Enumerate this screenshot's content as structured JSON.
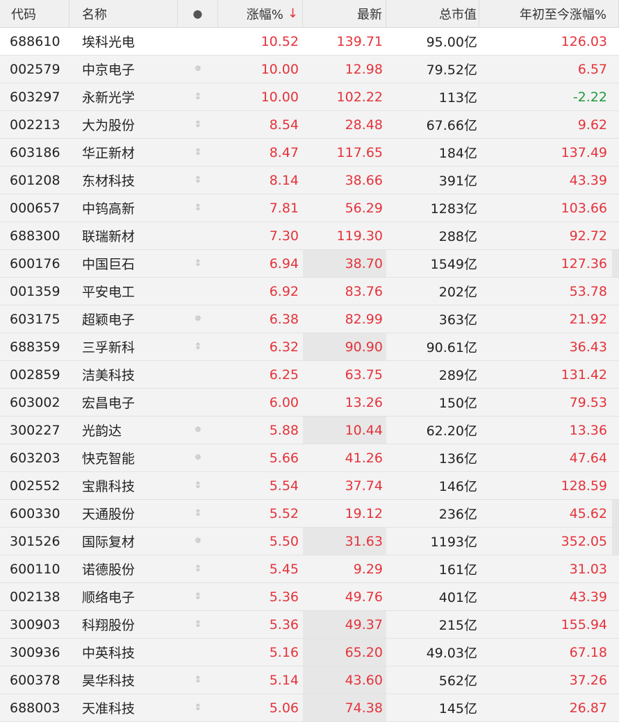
{
  "columns": {
    "code": "代码",
    "name": "名称",
    "dot": "●",
    "change_pct": "涨幅%",
    "sort_arrow": "↓",
    "last": "最新",
    "market_cap": "总市值",
    "ytd_pct": "年初至今涨幅%"
  },
  "rows": [
    {
      "code": "688610",
      "name": "埃科光电",
      "mark": "",
      "change": "10.52",
      "last": "139.71",
      "cap": "95.00亿",
      "ytd": "126.03",
      "ytd_dir": "up"
    },
    {
      "code": "002579",
      "name": "中京电子",
      "mark": "✵",
      "change": "10.00",
      "last": "12.98",
      "cap": "79.52亿",
      "ytd": "6.57",
      "ytd_dir": "up"
    },
    {
      "code": "603297",
      "name": "永新光学",
      "mark": "⇕",
      "change": "10.00",
      "last": "102.22",
      "cap": "113亿",
      "ytd": "-2.22",
      "ytd_dir": "down"
    },
    {
      "code": "002213",
      "name": "大为股份",
      "mark": "⇕",
      "change": "8.54",
      "last": "28.48",
      "cap": "67.66亿",
      "ytd": "9.62",
      "ytd_dir": "up"
    },
    {
      "code": "603186",
      "name": "华正新材",
      "mark": "⇕",
      "change": "8.47",
      "last": "117.65",
      "cap": "184亿",
      "ytd": "137.49",
      "ytd_dir": "up"
    },
    {
      "code": "601208",
      "name": "东材科技",
      "mark": "⇕",
      "change": "8.14",
      "last": "38.66",
      "cap": "391亿",
      "ytd": "43.39",
      "ytd_dir": "up"
    },
    {
      "code": "000657",
      "name": "中钨高新",
      "mark": "⇕",
      "change": "7.81",
      "last": "56.29",
      "cap": "1283亿",
      "ytd": "103.66",
      "ytd_dir": "up"
    },
    {
      "code": "688300",
      "name": "联瑞新材",
      "mark": "",
      "change": "7.30",
      "last": "119.30",
      "cap": "288亿",
      "ytd": "92.72",
      "ytd_dir": "up"
    },
    {
      "code": "600176",
      "name": "中国巨石",
      "mark": "⇕",
      "change": "6.94",
      "last": "38.70",
      "cap": "1549亿",
      "ytd": "127.36",
      "ytd_dir": "up"
    },
    {
      "code": "001359",
      "name": "平安电工",
      "mark": "",
      "change": "6.92",
      "last": "83.76",
      "cap": "202亿",
      "ytd": "53.78",
      "ytd_dir": "up"
    },
    {
      "code": "603175",
      "name": "超颖电子",
      "mark": "✵",
      "change": "6.38",
      "last": "82.99",
      "cap": "363亿",
      "ytd": "21.92",
      "ytd_dir": "up"
    },
    {
      "code": "688359",
      "name": "三孚新科",
      "mark": "⇕",
      "change": "6.32",
      "last": "90.90",
      "cap": "90.61亿",
      "ytd": "36.43",
      "ytd_dir": "up"
    },
    {
      "code": "002859",
      "name": "洁美科技",
      "mark": "",
      "change": "6.25",
      "last": "63.75",
      "cap": "289亿",
      "ytd": "131.42",
      "ytd_dir": "up"
    },
    {
      "code": "603002",
      "name": "宏昌电子",
      "mark": "",
      "change": "6.00",
      "last": "13.26",
      "cap": "150亿",
      "ytd": "79.53",
      "ytd_dir": "up"
    },
    {
      "code": "300227",
      "name": "光韵达",
      "mark": "✵",
      "change": "5.88",
      "last": "10.44",
      "cap": "62.20亿",
      "ytd": "13.36",
      "ytd_dir": "up"
    },
    {
      "code": "603203",
      "name": "快克智能",
      "mark": "✵",
      "change": "5.66",
      "last": "41.26",
      "cap": "136亿",
      "ytd": "47.64",
      "ytd_dir": "up"
    },
    {
      "code": "002552",
      "name": "宝鼎科技",
      "mark": "⇕",
      "change": "5.54",
      "last": "37.74",
      "cap": "146亿",
      "ytd": "128.59",
      "ytd_dir": "up"
    },
    {
      "code": "600330",
      "name": "天通股份",
      "mark": "⇕",
      "change": "5.52",
      "last": "19.12",
      "cap": "236亿",
      "ytd": "45.62",
      "ytd_dir": "up"
    },
    {
      "code": "301526",
      "name": "国际复材",
      "mark": "✵",
      "change": "5.50",
      "last": "31.63",
      "cap": "1193亿",
      "ytd": "352.05",
      "ytd_dir": "up"
    },
    {
      "code": "600110",
      "name": "诺德股份",
      "mark": "⇕",
      "change": "5.45",
      "last": "9.29",
      "cap": "161亿",
      "ytd": "31.03",
      "ytd_dir": "up"
    },
    {
      "code": "002138",
      "name": "顺络电子",
      "mark": "⇕",
      "change": "5.36",
      "last": "49.76",
      "cap": "401亿",
      "ytd": "43.39",
      "ytd_dir": "up"
    },
    {
      "code": "300903",
      "name": "科翔股份",
      "mark": "⇕",
      "change": "5.36",
      "last": "49.37",
      "cap": "215亿",
      "ytd": "155.94",
      "ytd_dir": "up"
    },
    {
      "code": "300936",
      "name": "中英科技",
      "mark": "",
      "change": "5.16",
      "last": "65.20",
      "cap": "49.03亿",
      "ytd": "67.18",
      "ytd_dir": "up"
    },
    {
      "code": "600378",
      "name": "昊华科技",
      "mark": "⇕",
      "change": "5.14",
      "last": "43.60",
      "cap": "562亿",
      "ytd": "37.26",
      "ytd_dir": "up"
    },
    {
      "code": "688003",
      "name": "天准科技",
      "mark": "⇕",
      "change": "5.06",
      "last": "74.38",
      "cap": "145亿",
      "ytd": "26.87",
      "ytd_dir": "up"
    }
  ],
  "colors": {
    "up": "#e5323a",
    "down": "#1e9a3c"
  }
}
